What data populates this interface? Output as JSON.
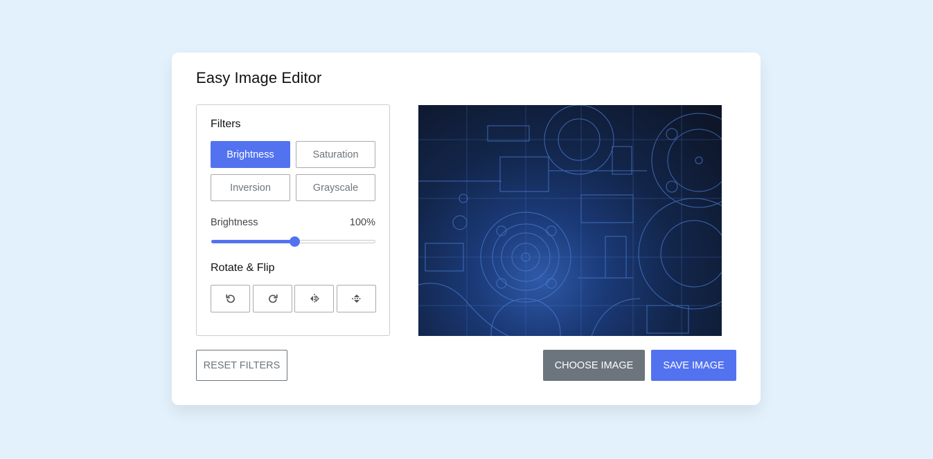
{
  "app": {
    "title": "Easy Image Editor"
  },
  "filters": {
    "heading": "Filters",
    "buttons": [
      {
        "label": "Brightness",
        "active": true
      },
      {
        "label": "Saturation",
        "active": false
      },
      {
        "label": "Inversion",
        "active": false
      },
      {
        "label": "Grayscale",
        "active": false
      }
    ]
  },
  "slider": {
    "name": "Brightness",
    "value_text": "100%",
    "value": 100,
    "max": 200
  },
  "rotate": {
    "heading": "Rotate & Flip",
    "icons": [
      "rotate-left-icon",
      "rotate-right-icon",
      "flip-horizontal-icon",
      "flip-vertical-icon"
    ]
  },
  "actions": {
    "reset_label": "Reset Filters",
    "choose_label": "Choose Image",
    "save_label": "Save Image"
  },
  "colors": {
    "accent": "#5372f0",
    "secondary": "#6c757d",
    "background": "#e3f1fd"
  }
}
